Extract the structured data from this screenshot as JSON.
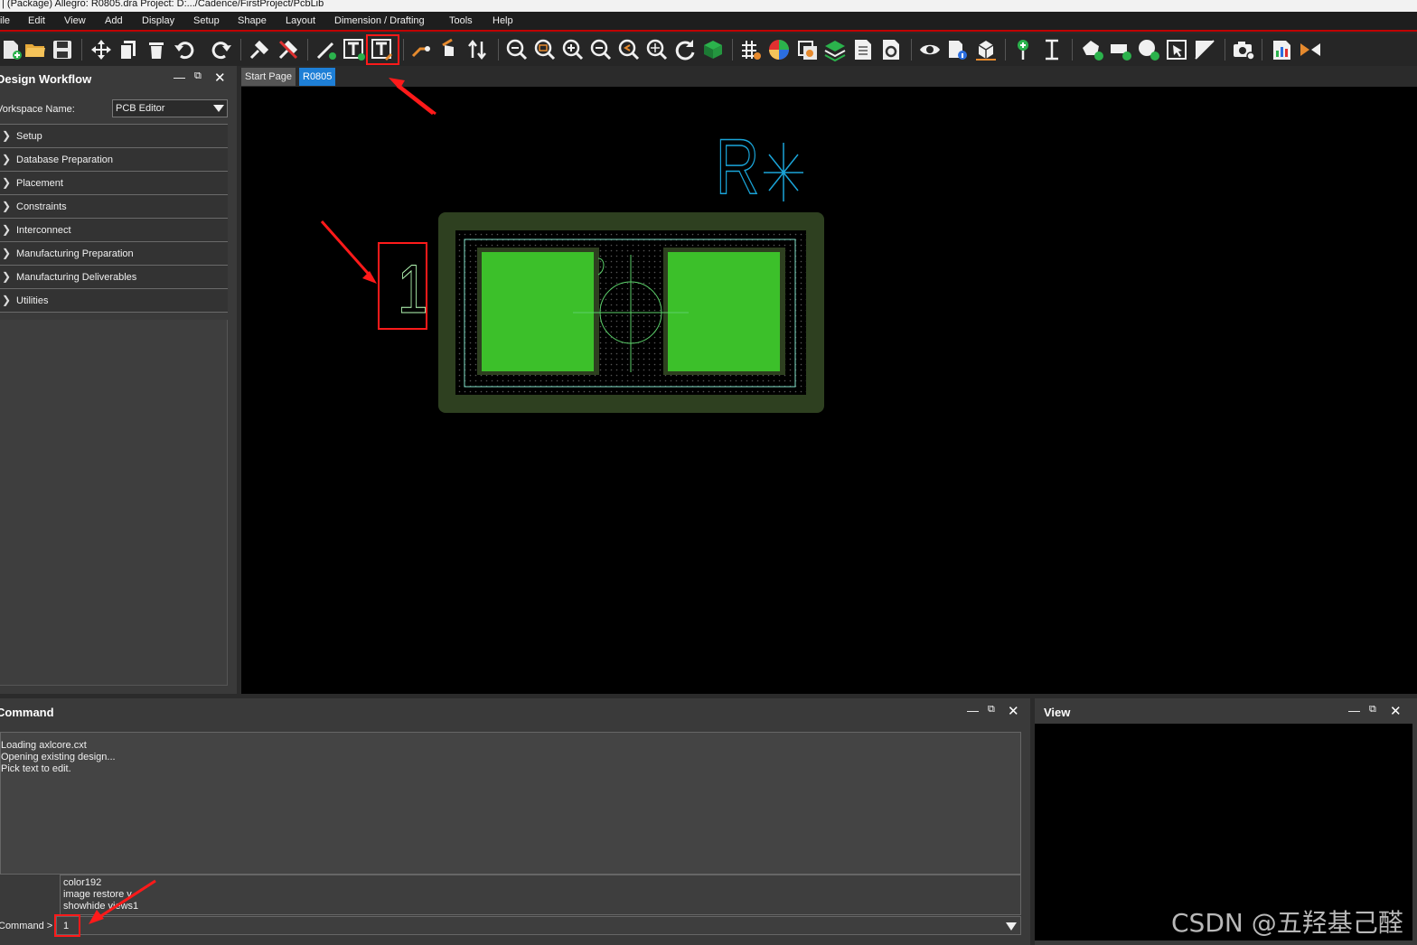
{
  "window": {
    "title": "| (Package) Allegro: R0805.dra  Project: D:.../Cadence/FirstProject/PcbLib"
  },
  "menu": [
    "ile",
    "Edit",
    "View",
    "Add",
    "Display",
    "Setup",
    "Shape",
    "Layout",
    "Dimension / Drafting",
    "Tools",
    "Help"
  ],
  "toolbar": {
    "icons": [
      "new-file-icon",
      "open-folder-icon",
      "save-icon",
      "move-icon",
      "copy-icon",
      "delete-icon",
      "undo-icon",
      "redo-icon",
      "fix-pin-icon",
      "unfix-pin-icon",
      "add-line-icon",
      "add-text-icon",
      "edit-text-icon",
      "route-connect-icon",
      "slide-icon",
      "swap-icon",
      "zoom-fit-icon",
      "zoom-window-icon",
      "zoom-in-icon",
      "zoom-out-icon",
      "zoom-world-icon",
      "zoom-center-icon",
      "redraw-icon",
      "board-view-icon",
      "grid-icon",
      "color-palette-icon",
      "shadow-mode-icon",
      "layers-icon",
      "reports-icon",
      "settings-icon",
      "visibility-icon",
      "show-element-icon",
      "3d-view-icon",
      "add-pin-icon",
      "dimension-icon",
      "add-shape-icon",
      "add-rect-icon",
      "add-circle-icon",
      "select-shape-icon",
      "merge-shapes-icon",
      "camera-icon",
      "report-chart-icon",
      "swap-arrows-icon"
    ]
  },
  "design_workflow": {
    "title": "Design Workflow",
    "workspace_label": "Vorkspace Name:",
    "workspace_value": "PCB Editor",
    "items": [
      {
        "label": "Setup"
      },
      {
        "label": "Database Preparation"
      },
      {
        "label": "Placement"
      },
      {
        "label": "Constraints"
      },
      {
        "label": "Interconnect"
      },
      {
        "label": "Manufacturing Preparation"
      },
      {
        "label": "Manufacturing Deliverables"
      },
      {
        "label": "Utilities"
      }
    ]
  },
  "tabs": [
    {
      "label": "Start Page",
      "active": false
    },
    {
      "label": "R0805",
      "active": true
    }
  ],
  "canvas": {
    "refdes_text": "R",
    "pin_number_text": "1"
  },
  "command": {
    "title": "Command",
    "output_lines": [
      "Loading axlcore.cxt",
      "Opening existing design...",
      "Pick text to edit."
    ],
    "history": [
      "color192",
      "image restore v",
      "showhide views1"
    ],
    "prompt_label": "Command >",
    "input_value": "1"
  },
  "view_panel": {
    "title": "View"
  },
  "watermark": "CSDN @五羟基己醛",
  "colors": {
    "accent_red": "#ff1a1a",
    "pad_green": "#3cc02a",
    "body_green": "#2e4020",
    "tab_active": "#1e7fd6",
    "refdes_cyan": "#1aa4d8"
  }
}
